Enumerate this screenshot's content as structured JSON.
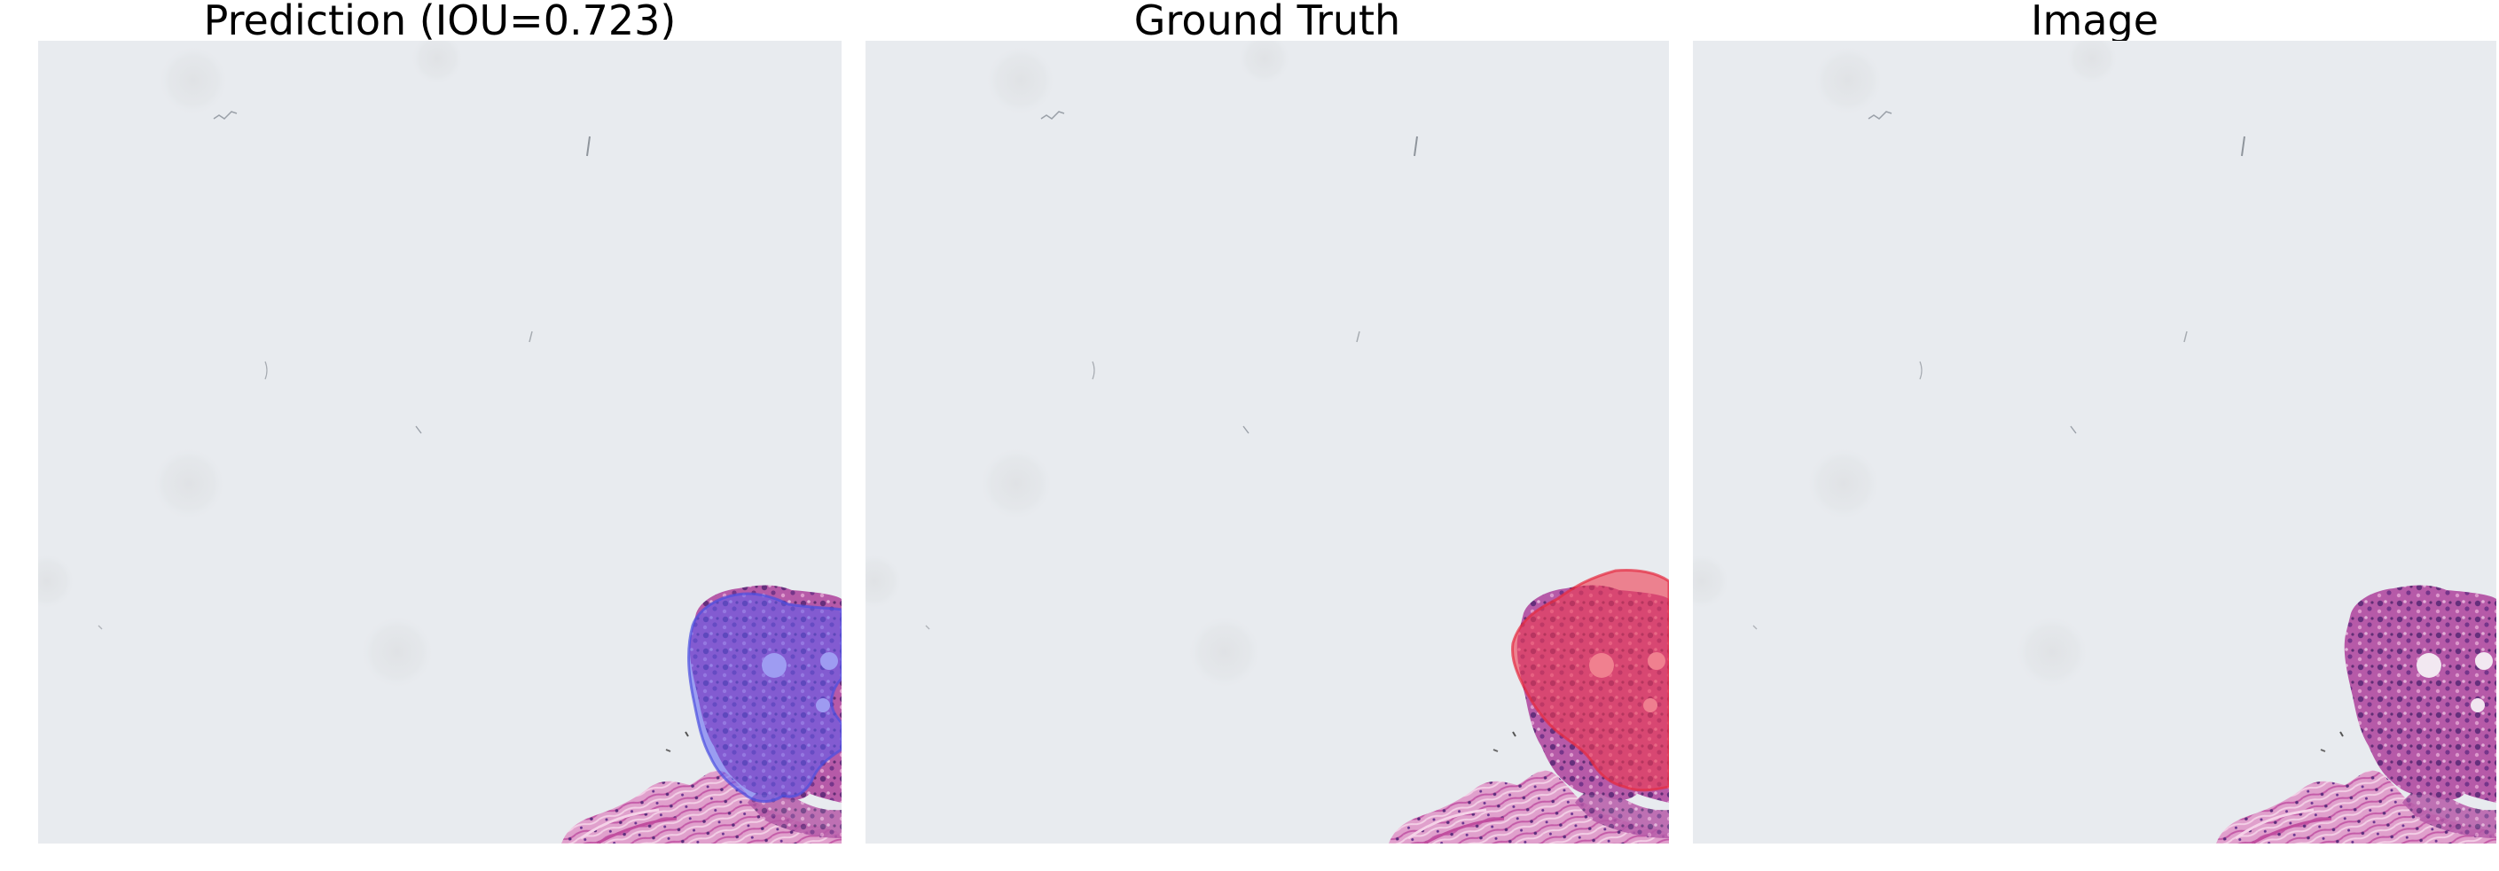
{
  "figure": {
    "panels": [
      {
        "id": "prediction",
        "title": "Prediction (IOU=0.723)",
        "overlay": "prediction-mask",
        "overlay_color": "#5a5cf2",
        "iou": 0.723
      },
      {
        "id": "ground-truth",
        "title": "Ground Truth",
        "overlay": "ground-truth-mask",
        "overlay_color": "#ef3b4f"
      },
      {
        "id": "image",
        "title": "Image",
        "overlay": "none"
      }
    ]
  },
  "colors": {
    "background": "#e8ebef",
    "tissue": "#b04a9d",
    "nuclei": "#5a2a7a",
    "stroma": "#e5a7cf",
    "prediction_overlay": "#5a5cf2",
    "ground_truth_overlay": "#ef3b4f"
  }
}
